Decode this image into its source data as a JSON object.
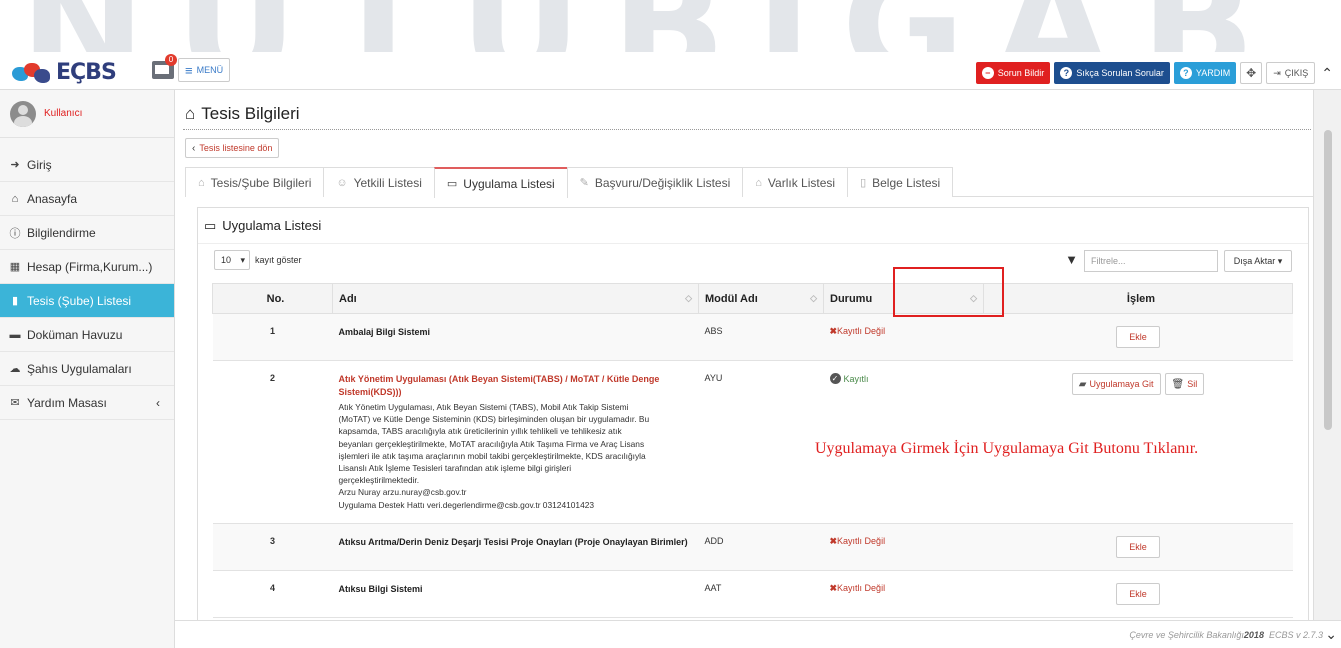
{
  "watermark": "NUTUBIGAB",
  "header": {
    "logo_text": "EÇBS",
    "mail_badge": "0",
    "menu_label": "MENÜ",
    "buttons": {
      "report": "Sorun Bildir",
      "faq": "Sıkça Sorulan Sorular",
      "help": "YARDIM",
      "logout": "ÇIKIŞ"
    }
  },
  "sidebar": {
    "user": "Kullanıcı",
    "items": [
      {
        "label": "Giriş",
        "icon": "sign-in-icon"
      },
      {
        "label": "Anasayfa",
        "icon": "home-icon"
      },
      {
        "label": "Bilgilendirme",
        "icon": "info-icon"
      },
      {
        "label": "Hesap (Firma,Kurum...)",
        "icon": "building-icon"
      },
      {
        "label": "Tesis (Şube) Listesi",
        "icon": "facility-icon",
        "active": true
      },
      {
        "label": "Doküman Havuzu",
        "icon": "documents-icon"
      },
      {
        "label": "Şahıs Uygulamaları",
        "icon": "cloud-icon"
      },
      {
        "label": "Yardım Masası",
        "icon": "mail-icon"
      }
    ]
  },
  "page": {
    "title": "Tesis Bilgileri",
    "back_label": "Tesis listesine dön",
    "tabs": [
      "Tesis/Şube Bilgileri",
      "Yetkili Listesi",
      "Uygulama Listesi",
      "Başvuru/Değişiklik Listesi",
      "Varlık Listesi",
      "Belge Listesi"
    ],
    "active_tab": "Uygulama Listesi"
  },
  "panel": {
    "title": "Uygulama Listesi",
    "page_length": "10",
    "page_length_label": "kayıt göster",
    "filter_placeholder": "Filtrele...",
    "export_label": "Dışa Aktar"
  },
  "table": {
    "columns": [
      "No.",
      "Adı",
      "Modül Adı",
      "Durumu",
      "İşlem"
    ],
    "rows": [
      {
        "no": "1",
        "name": "Ambalaj Bilgi Sistemi",
        "module": "ABS",
        "status": "Kayıtlı Değil",
        "action": "Ekle"
      },
      {
        "no": "2",
        "name": "Atık Yönetim Uygulaması (Atık Beyan Sistemi(TABS) / MoTAT / Kütle Denge Sistemi(KDS)))",
        "desc": [
          "Atık Yönetim Uygulaması, Atık Beyan Sistemi (TABS), Mobil Atık Takip Sistemi",
          "(MoTAT) ve Kütle Denge Sisteminin (KDS) birleşiminden oluşan bir uygulamadır. Bu",
          "kapsamda, TABS aracılığıyla atık üreticilerinin yıllık tehlikeli ve tehlikesiz atık",
          "beyanları gerçekleştirilmekte, MoTAT aracılığıyla Atık Taşıma Firma ve Araç Lisans",
          "işlemleri ile atık taşıma araçlarının mobil takibi gerçekleştirilmekte, KDS aracılığıyla",
          "Lisanslı Atık İşleme Tesisleri tarafından atık işleme bilgi girişleri",
          "gerçekleştirilmektedir.",
          "Arzu Nuray arzu.nuray@csb.gov.tr",
          "Uygulama Destek Hattı veri.degerlendirme@csb.gov.tr 03124101423"
        ],
        "module": "AYU",
        "status": "Kayıtlı",
        "action_go": "Uygulamaya Git",
        "action_delete": "Sil"
      },
      {
        "no": "3",
        "name": "Atıksu Arıtma/Derin Deniz Deşarjı Tesisi Proje Onayları (Proje Onaylayan Birimler)",
        "module": "ADD",
        "status": "Kayıtlı Değil",
        "action": "Ekle"
      },
      {
        "no": "4",
        "name": "Atıksu Bilgi Sistemi",
        "module": "AAT",
        "status": "Kayıtlı Değil",
        "action": "Ekle"
      }
    ]
  },
  "annotation": "Uygulamaya Girmek İçin Uygulamaya Git Butonu Tıklanır.",
  "footer": {
    "ministry": "Çevre ve Şehircilik Bakanlığı",
    "year": "2018",
    "version": "ECBS v 2.7.3"
  },
  "colors": {
    "accent_red": "#e02020",
    "active_nav": "#3bb4d8",
    "navy": "#1d4e8f",
    "help_blue": "#2a9ed8"
  }
}
